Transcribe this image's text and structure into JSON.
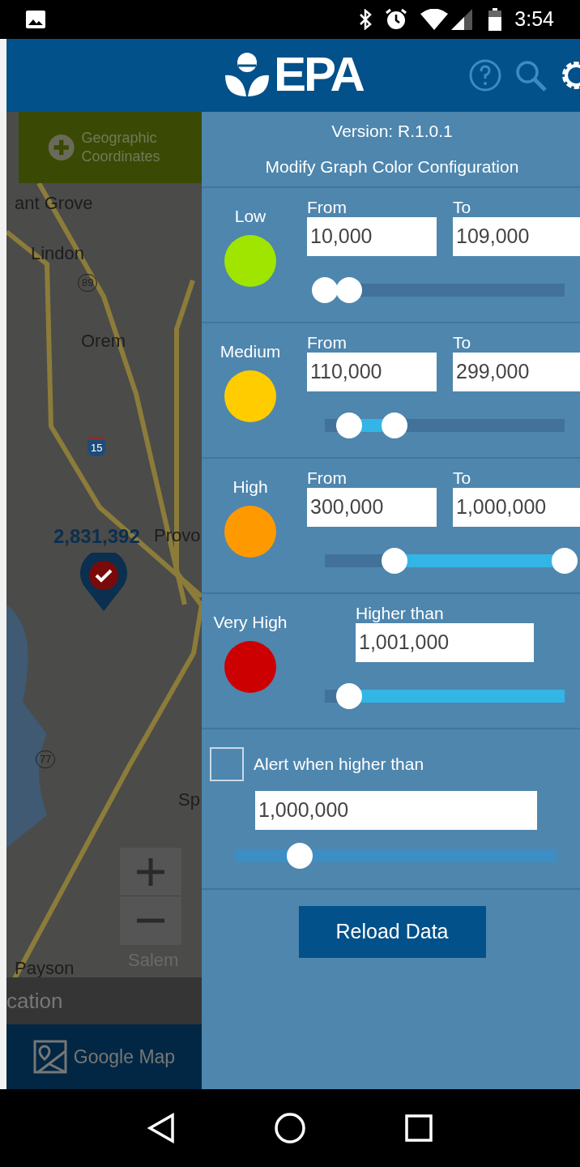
{
  "status_bar": {
    "time": "3:54"
  },
  "header": {
    "logo": "EPA"
  },
  "map": {
    "coordinates_button": "Geographic Coordinates",
    "labels": [
      {
        "text": "ant Grove",
        "kind": "place"
      },
      {
        "text": "Lindon",
        "kind": "place"
      },
      {
        "text": "89",
        "kind": "shield"
      },
      {
        "text": "Orem",
        "kind": "place"
      },
      {
        "text": "15",
        "kind": "interstate"
      },
      {
        "text": "2,831,392",
        "kind": "marker"
      },
      {
        "text": "Provo",
        "kind": "place"
      },
      {
        "text": "77",
        "kind": "shield"
      },
      {
        "text": "Sp",
        "kind": "place"
      },
      {
        "text": "Salem",
        "kind": "faint"
      },
      {
        "text": "Payson",
        "kind": "place"
      }
    ],
    "location_bar": "cation",
    "tab": "Google Map"
  },
  "panel": {
    "version": "Version: R.1.0.1",
    "title": "Modify Graph Color Configuration",
    "levels": [
      {
        "name": "Low",
        "color": "#a0e500",
        "kind": "range",
        "from_label": "From",
        "from": "10,000",
        "to_label": "To",
        "to": "109,000",
        "thumbs": [
          {
            "level": 0.0
          },
          {
            "level": 0.1
          }
        ]
      },
      {
        "name": "Medium",
        "color": "#ffcc00",
        "kind": "range",
        "from_label": "From",
        "from": "110,000",
        "to_label": "To",
        "to": "299,000",
        "thumbs": [
          {
            "level": 0.1
          },
          {
            "level": 0.29
          }
        ]
      },
      {
        "name": "High",
        "color": "#ff9900",
        "kind": "range",
        "from_label": "From",
        "from": "300,000",
        "to_label": "To",
        "to": "1,000,000",
        "thumbs": [
          {
            "level": 0.29
          },
          {
            "level": 1.0
          }
        ]
      },
      {
        "name": "Very High",
        "color": "#cc0000",
        "kind": "above",
        "from_label": "Higher than",
        "from": "1,001,000",
        "thumbs": [
          {
            "level": 0.1
          }
        ]
      }
    ],
    "alert": {
      "label": "Alert when higher than",
      "checked": false,
      "value": "1,000,000",
      "level": 0.2
    },
    "reload_button": "Reload Data"
  }
}
